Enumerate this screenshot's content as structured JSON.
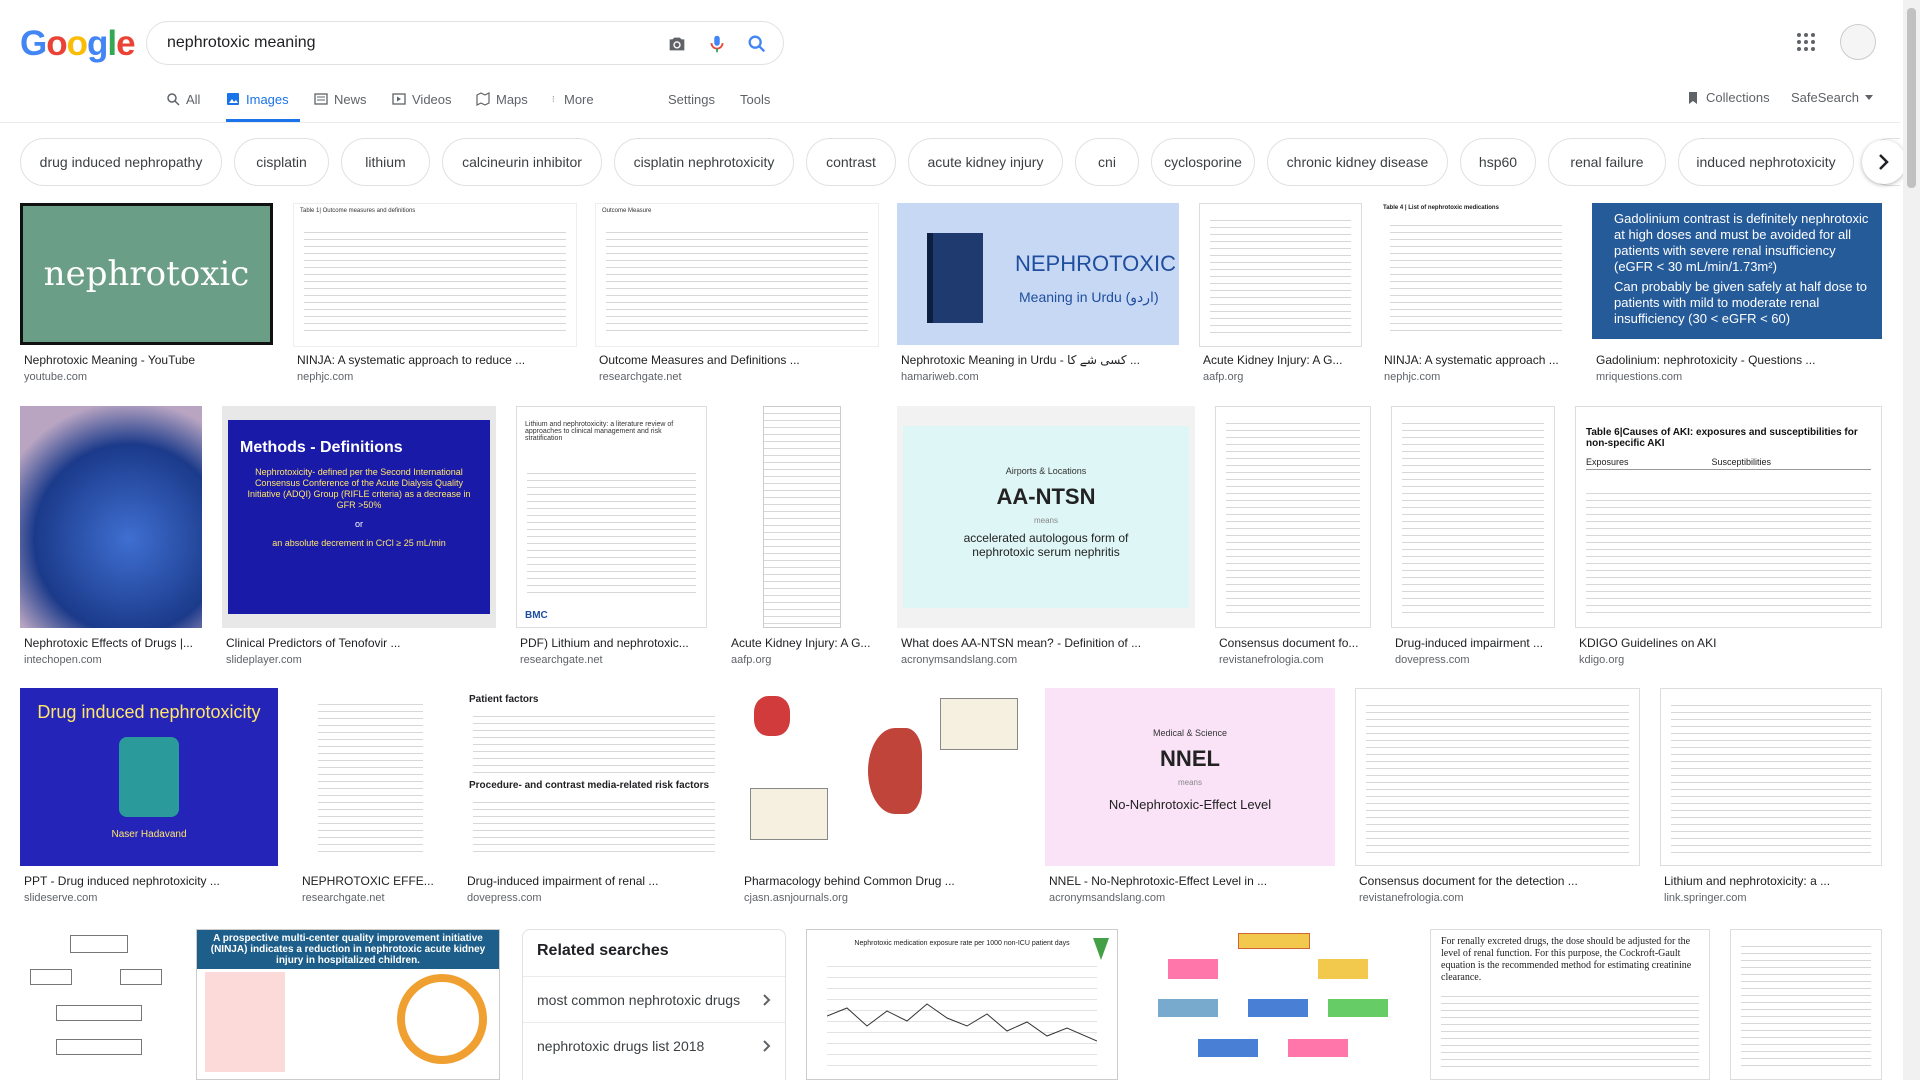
{
  "colors": {
    "accent": "#1a73e8",
    "g_blue": "#4285F4",
    "g_red": "#EA4335",
    "g_yellow": "#FBBC05",
    "g_green": "#34A853"
  },
  "logo": [
    "G",
    "o",
    "o",
    "g",
    "l",
    "e"
  ],
  "search": {
    "query": "nephrotoxic meaning"
  },
  "icons": {
    "camera": "camera-icon",
    "mic": "mic-icon",
    "search": "search-icon",
    "apps": "apps-grid-icon",
    "avatar": "avatar-icon"
  },
  "tabs": [
    {
      "label": "All",
      "icon": "search-icon",
      "active": false
    },
    {
      "label": "Images",
      "icon": "image-icon",
      "active": true
    },
    {
      "label": "News",
      "icon": "news-icon",
      "active": false
    },
    {
      "label": "Videos",
      "icon": "video-icon",
      "active": false
    },
    {
      "label": "Maps",
      "icon": "map-icon",
      "active": false
    },
    {
      "label": "More",
      "icon": "more-icon",
      "active": false
    }
  ],
  "tools": {
    "settings": "Settings",
    "tools": "Tools",
    "collections": "Collections",
    "safesearch": "SafeSearch"
  },
  "chips": [
    "drug induced nephropathy",
    "cisplatin",
    "lithium",
    "calcineurin inhibitor",
    "cisplatin nephrotoxicity",
    "contrast",
    "acute kidney injury",
    "cni",
    "cyclosporine",
    "chronic kidney disease",
    "hsp60",
    "renal failure",
    "induced nephrotoxicity",
    "g"
  ],
  "results": [
    {
      "title": "Nephrotoxic Meaning - YouTube",
      "site": "youtube.com",
      "thumb_text": "nephrotoxic"
    },
    {
      "title": "NINJA: A systematic approach to reduce ...",
      "site": "nephjc.com",
      "thumb_text": "Table 1| Outcome measures and definitions"
    },
    {
      "title": "Outcome Measures and Definitions ...",
      "site": "researchgate.net",
      "thumb_text": "Outcome Measure"
    },
    {
      "title": "Nephrotoxic Meaning in Urdu - کسی شے کا ...",
      "site": "hamariweb.com",
      "thumb_text": "NEPHROTOXIC",
      "thumb_sub": "Meaning in Urdu (اردو)"
    },
    {
      "title": "Acute Kidney Injury: A G...",
      "site": "aafp.org",
      "thumb_text": ""
    },
    {
      "title": "NINJA: A systematic approach ...",
      "site": "nephjc.com",
      "thumb_text": "Table 4 | List of nephrotoxic medications"
    },
    {
      "title": "Gadolinium: nephrotoxicity - Questions ...",
      "site": "mriquestions.com",
      "thumb_text": "Gadolinium contrast is definitely nephrotoxic at high doses and must be avoided for all patients with severe renal insufficiency (eGFR < 30 mL/min/1.73m²)",
      "thumb_sub": "Can probably be given safely at half dose to patients with mild to moderate renal insufficiency (30 < eGFR < 60)"
    },
    {
      "title": "Nephrotoxic Effects of Drugs |...",
      "site": "intechopen.com",
      "thumb_text": ""
    },
    {
      "title": "Clinical Predictors of Tenofovir ...",
      "site": "slideplayer.com",
      "thumb_text": "Methods - Definitions",
      "thumb_sub": "Nephrotoxicity- defined per the Second International Consensus Conference of the Acute Dialysis Quality Initiative (ADQI) Group (RIFLE criteria) as a decrease in GFR >50%",
      "thumb_sub2": "or",
      "thumb_sub3": "an absolute decrement in CrCl ≥ 25 mL/min"
    },
    {
      "title": "PDF) Lithium and nephrotoxic...",
      "site": "researchgate.net",
      "thumb_text": "Lithium and nephrotoxicity: a literature review of approaches to clinical management and risk stratification",
      "thumb_sub": "BMC"
    },
    {
      "title": "Acute Kidney Injury: A G...",
      "site": "aafp.org",
      "thumb_text": ""
    },
    {
      "title": "What does AA-NTSN mean? - Definition of ...",
      "site": "acronymsandslang.com",
      "thumb_text": "AA-NTSN",
      "thumb_sub": "accelerated autologous form of nephrotoxic serum nephritis",
      "thumb_label": "Airports & Locations",
      "thumb_means": "means"
    },
    {
      "title": "Consensus document fo...",
      "site": "revistanefrologia.com",
      "thumb_text": ""
    },
    {
      "title": "Drug-induced impairment ...",
      "site": "dovepress.com",
      "thumb_text": ""
    },
    {
      "title": "KDIGO Guidelines on AKI",
      "site": "kdigo.org",
      "thumb_text": "Table 6|Causes of AKI: exposures and susceptibilities for non-specific AKI",
      "thumb_sub": "Exposures",
      "thumb_sub2": "Susceptibilities"
    },
    {
      "title": "PPT - Drug induced nephrotoxicity ...",
      "site": "slideserve.com",
      "thumb_text": "Drug induced nephrotoxicity",
      "thumb_sub": "Naser Hadavand"
    },
    {
      "title": "NEPHROTOXIC EFFE...",
      "site": "researchgate.net",
      "thumb_text": ""
    },
    {
      "title": "Drug-induced impairment of renal ...",
      "site": "dovepress.com",
      "thumb_text": "Patient factors",
      "thumb_sub": "Procedure- and contrast media-related risk factors"
    },
    {
      "title": "Pharmacology behind Common Drug ...",
      "site": "cjasn.asnjournals.org",
      "thumb_text": ""
    },
    {
      "title": "NNEL - No-Nephrotoxic-Effect Level in ...",
      "site": "acronymsandslang.com",
      "thumb_text": "NNEL",
      "thumb_sub": "No-Nephrotoxic-Effect Level",
      "thumb_label": "Medical & Science",
      "thumb_means": "means"
    },
    {
      "title": "Consensus document for the detection ...",
      "site": "revistanefrologia.com",
      "thumb_text": ""
    },
    {
      "title": "Lithium and nephrotoxicity: a ...",
      "site": "link.springer.com",
      "thumb_text": ""
    },
    {
      "title": "",
      "site": "",
      "thumb_text": ""
    },
    {
      "title": "",
      "site": "",
      "thumb_text": "A prospective multi-center quality improvement initiative (NINJA) indicates a reduction in nephrotoxic acute kidney injury in hospitalized children."
    },
    {
      "title": "",
      "site": "",
      "thumb_text": "Nephrotoxic medication exposure rate per 1000 non-ICU patient days"
    },
    {
      "title": "",
      "site": "",
      "thumb_text": ""
    },
    {
      "title": "",
      "site": "",
      "thumb_text": "For renally excreted drugs, the dose should be adjusted for the level of renal function. For this purpose, the Cockroft-Gault equation is the recommended method for estimating creatinine clearance."
    },
    {
      "title": "",
      "site": "",
      "thumb_text": ""
    }
  ],
  "related": {
    "title": "Related searches",
    "items": [
      "most common nephrotoxic drugs",
      "nephrotoxic drugs list 2018"
    ]
  }
}
